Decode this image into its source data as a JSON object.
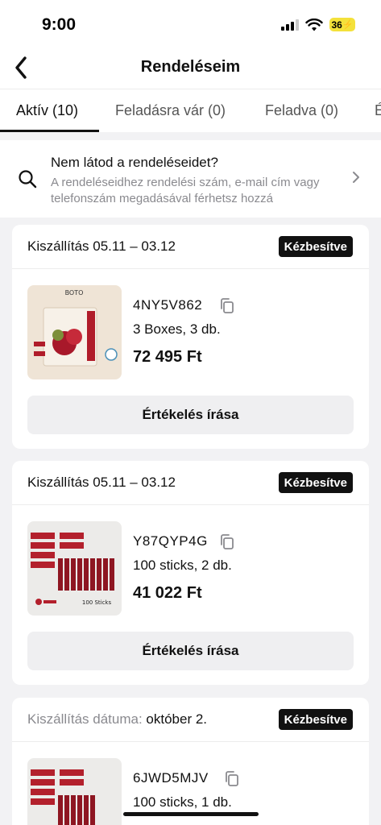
{
  "status_bar": {
    "time": "9:00",
    "battery": "36"
  },
  "nav": {
    "title": "Rendeléseim",
    "back_icon": "chevron-left-icon"
  },
  "tabs": [
    {
      "label": "Aktív (10)",
      "active": true
    },
    {
      "label": "Feladásra vár (0)",
      "active": false
    },
    {
      "label": "Feladva (0)",
      "active": false
    },
    {
      "label": "É",
      "active": false
    }
  ],
  "notice": {
    "icon": "search-icon",
    "title": "Nem látod a rendeléseidet?",
    "subtitle": "A rendeléseidhez rendelési szám, e-mail cím vagy telefonszám megadásával férhetsz hozzá"
  },
  "orders": [
    {
      "delivery_label": "Kiszállítás 05.11 – 03.12",
      "status": "Kézbesítve",
      "order_id": "4NY5V862",
      "quantity": "3 Boxes, 3 db.",
      "price": "72 495 Ft",
      "review_label": "Értékelés írása",
      "thumb_text": "BOTO"
    },
    {
      "delivery_label": "Kiszállítás 05.11 – 03.12",
      "status": "Kézbesítve",
      "order_id": "Y87QYP4G",
      "quantity": "100 sticks, 2 db.",
      "price": "41 022 Ft",
      "review_label": "Értékelés írása",
      "thumb_text": "100 Sticks"
    },
    {
      "delivery_label_prefix": "Kiszállítás dátuma:",
      "delivery_label_date": "október 2.",
      "status": "Kézbesítve",
      "order_id": "6JWD5MJV",
      "quantity": "100 sticks, 1 db."
    }
  ],
  "colors": {
    "accent": "#111111",
    "muted": "#8a8a8f",
    "badge_bg": "#111111",
    "background": "#f2f2f4",
    "battery": "#f4e13b"
  }
}
